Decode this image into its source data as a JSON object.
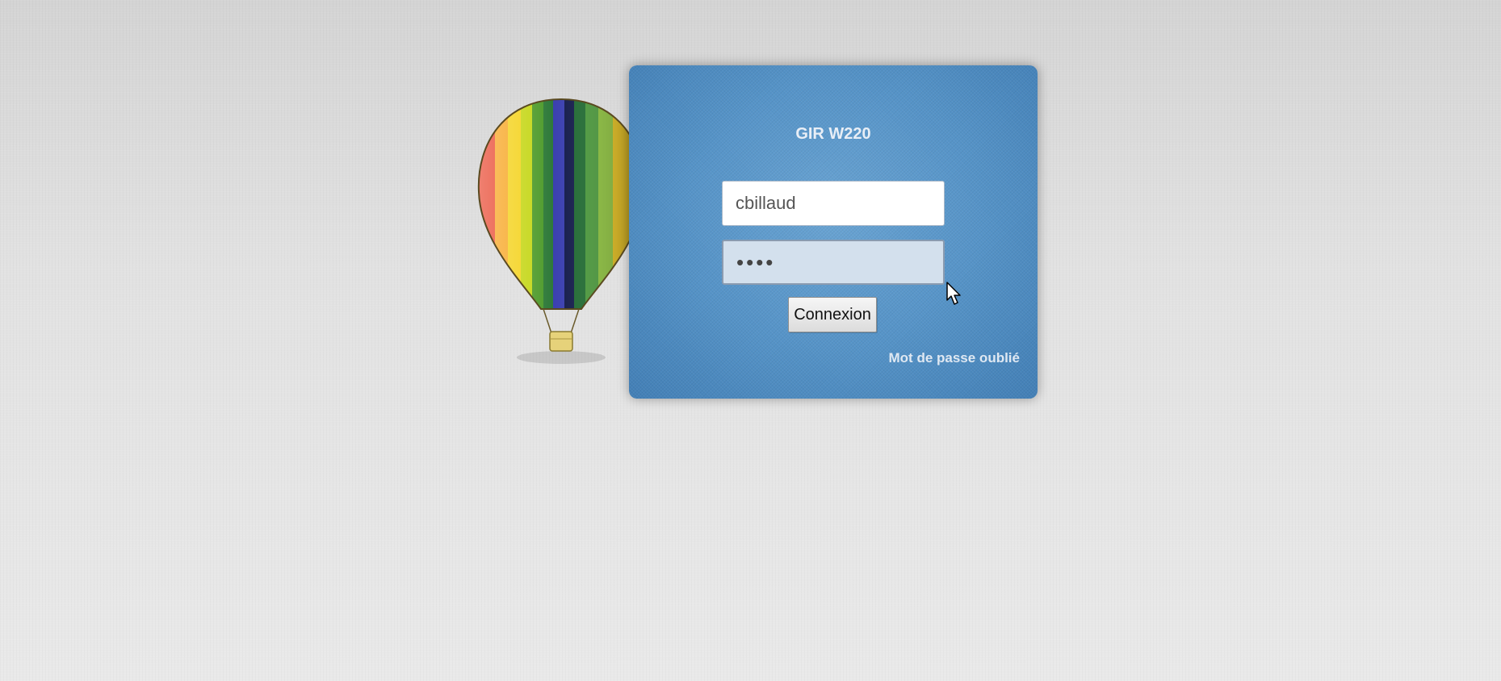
{
  "login": {
    "title": "GIR W220",
    "username_value": "cbillaud",
    "password_value": "••••",
    "connect_label": "Connexion",
    "forgot_label": "Mot de passe oublié"
  },
  "logo": {
    "icon": "hot-air-balloon-icon"
  },
  "colors": {
    "panel": "#5694c8",
    "background": "#e2e2e2"
  }
}
